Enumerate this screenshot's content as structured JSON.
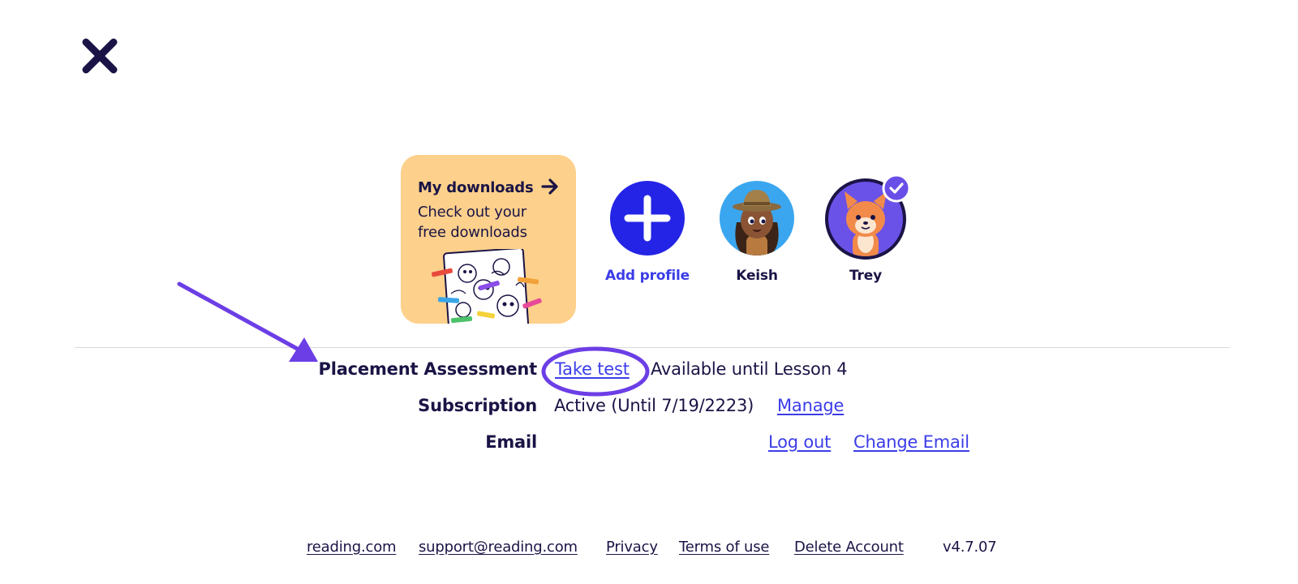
{
  "header": {
    "close_icon": "close-icon"
  },
  "downloads_card": {
    "title": "My downloads",
    "description": "Check out your free downloads",
    "arrow_icon": "arrow-right-icon",
    "background": "#fdd08b"
  },
  "profiles": [
    {
      "label": "Add profile",
      "icon": "plus-icon",
      "color": "#2424e6"
    },
    {
      "label": "Keish",
      "icon": "avatar-keish"
    },
    {
      "label": "Trey",
      "icon": "avatar-trey",
      "selected": true,
      "badge_icon": "check-badge-icon"
    }
  ],
  "account": {
    "placement": {
      "label": "Placement Assessment",
      "link": "Take test",
      "note": "Available until Lesson 4"
    },
    "subscription": {
      "label": "Subscription",
      "status": "Active (Until 7/19/2223)",
      "link": "Manage"
    },
    "email": {
      "label": "Email",
      "logout": "Log out",
      "change": "Change Email"
    }
  },
  "footer": {
    "links": [
      "reading.com",
      "support@reading.com",
      "Privacy",
      "Terms of use",
      "Delete Account"
    ],
    "version": "v4.7.07"
  },
  "colors": {
    "text_dark": "#1a1446",
    "link_blue": "#3b3de8",
    "annotation_purple": "#6c3ee6",
    "card_yellow": "#fdd08b"
  }
}
